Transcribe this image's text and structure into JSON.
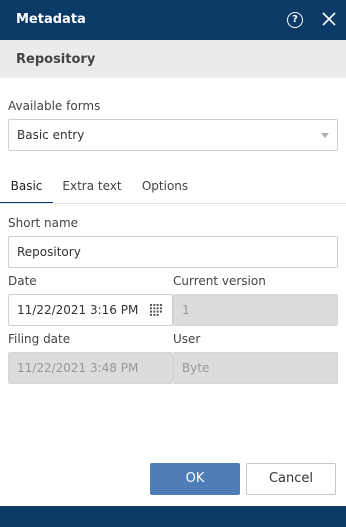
{
  "window": {
    "title": "Metadata",
    "help_glyph": "?"
  },
  "section": {
    "title": "Repository"
  },
  "available_forms": {
    "label": "Available forms",
    "selected": "Basic entry"
  },
  "tabs": [
    {
      "label": "Basic",
      "active": true
    },
    {
      "label": "Extra text",
      "active": false
    },
    {
      "label": "Options",
      "active": false
    }
  ],
  "fields": {
    "short_name": {
      "label": "Short name",
      "value": "Repository"
    },
    "date": {
      "label": "Date",
      "value": "11/22/2021 3:16 PM"
    },
    "current_version": {
      "label": "Current version",
      "value": "1"
    },
    "filing_date": {
      "label": "Filing date",
      "value": "11/22/2021 3:48 PM"
    },
    "user": {
      "label": "User",
      "value": "Byte"
    }
  },
  "buttons": {
    "ok": "OK",
    "cancel": "Cancel"
  },
  "colors": {
    "header": "#0b3a66",
    "primary_button": "#4e7db8",
    "section_bg": "#ebebeb",
    "disabled_field": "#dcdcdc"
  }
}
